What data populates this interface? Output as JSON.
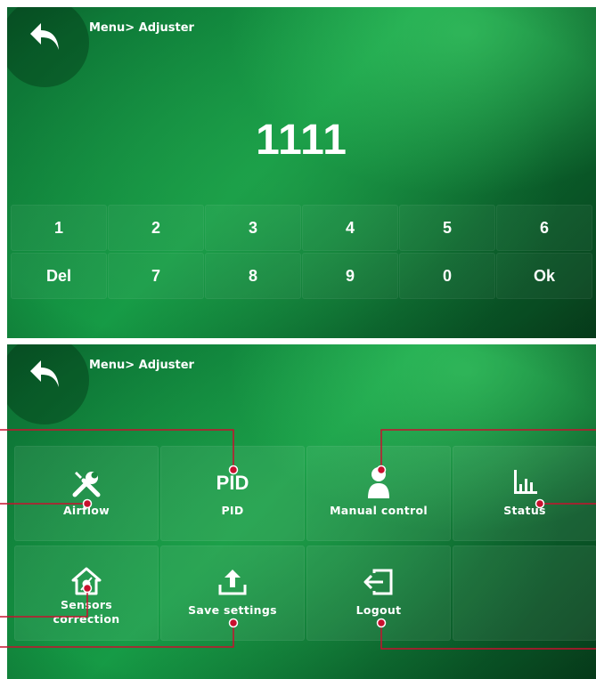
{
  "login_screen": {
    "breadcrumb": "Menu> Adjuster",
    "code_value": "1111",
    "keypad_keys": [
      "1",
      "2",
      "3",
      "4",
      "5",
      "6",
      "Del",
      "7",
      "8",
      "9",
      "0",
      "Ok"
    ]
  },
  "menu_screen": {
    "breadcrumb": "Menu> Adjuster",
    "tiles": [
      {
        "label": "Airflow",
        "icon": "tools-icon"
      },
      {
        "label": "PID",
        "icon_text": "PID"
      },
      {
        "label": "Manual control",
        "icon": "person-icon"
      },
      {
        "label": "Status",
        "icon": "bar-chart-icon"
      },
      {
        "label": "Sensors correction",
        "icon": "house-sensor-icon"
      },
      {
        "label": "Save settings",
        "icon": "upload-icon"
      },
      {
        "label": "Logout",
        "icon": "logout-icon"
      }
    ]
  },
  "colors": {
    "callout_line": "#c8102e",
    "background_green": "#159a45",
    "text": "#ffffff"
  }
}
